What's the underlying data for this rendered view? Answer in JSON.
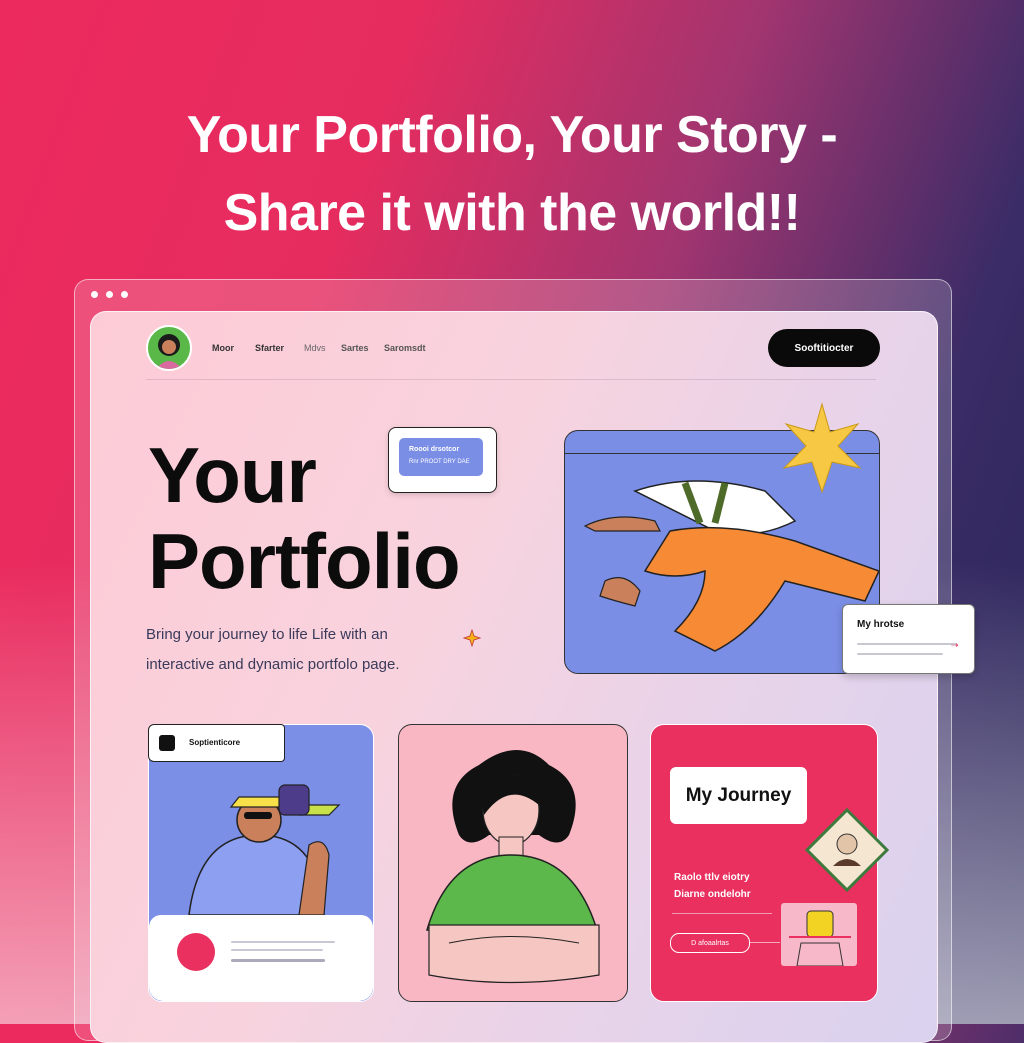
{
  "headline": {
    "line1": "Your Portfolio, Your Story -",
    "line2": "Share it with the world!!"
  },
  "nav": {
    "items": [
      "Moor",
      "Sfarter",
      "Mdvs",
      "Sartes",
      "Saromsdt"
    ]
  },
  "header": {
    "cta_label": "Sooftitiocter"
  },
  "hero": {
    "title_line1": "Your",
    "title_line2": "Portfolio",
    "description_line1": "Bring your journey to life Life with an",
    "description_line2": "interactive and dynamic portfolo page."
  },
  "float_card": {
    "line1": "Roooi drsotcor",
    "line2": "Rnr PROOT DRY DAE"
  },
  "note_card": {
    "title": "My hrotse"
  },
  "cards": {
    "card1_tag": "Soptienticore",
    "card3_title": "My Journey",
    "card3_line1": "Raolo ttlv eiotry",
    "card3_line2": "Diarne ondelohr",
    "card3_pill": "D afoaalrtas"
  },
  "colors": {
    "accent_pink": "#e9305f",
    "periwinkle": "#7a8ee6",
    "green": "#59b847",
    "orange": "#f68a35"
  }
}
